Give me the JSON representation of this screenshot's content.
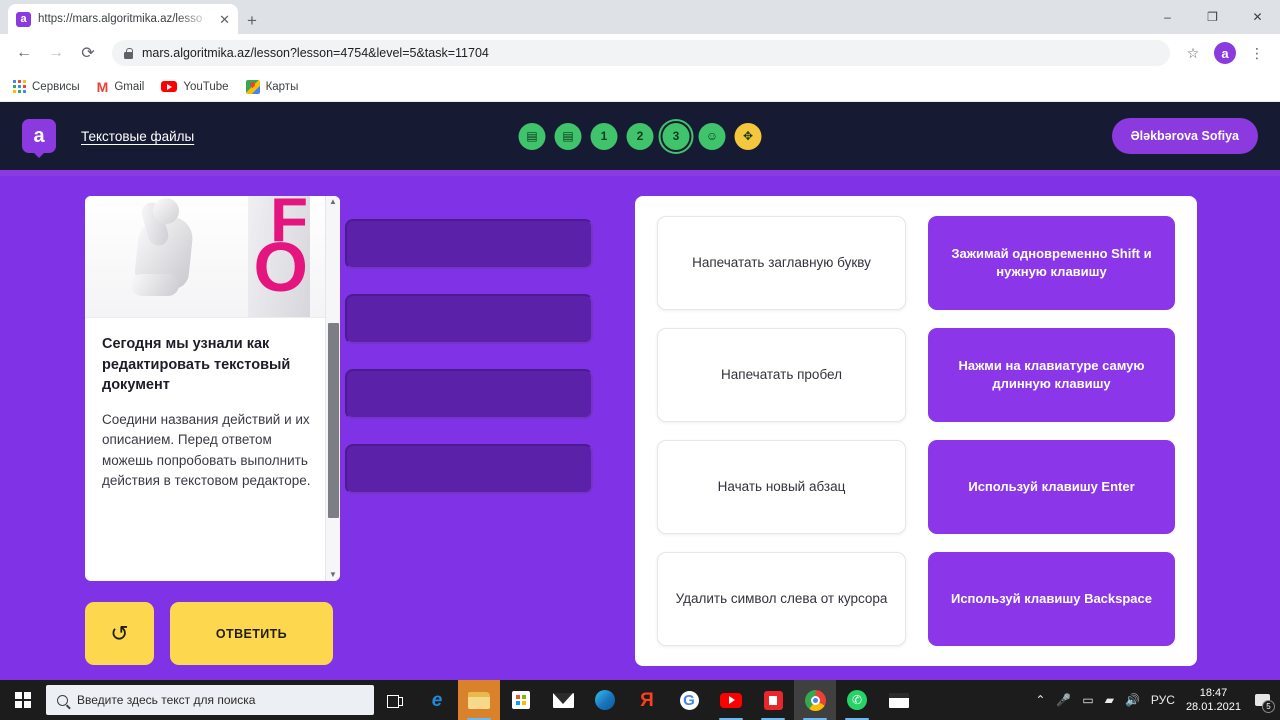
{
  "browser": {
    "tab": {
      "favicon_letter": "a",
      "title": "https://mars.algoritmika.az/lesso",
      "close_icon": "✕"
    },
    "new_tab_icon": "+",
    "window_controls": {
      "minimize": "–",
      "maximize": "❐",
      "close": "✕"
    },
    "nav": {
      "back": "←",
      "forward": "→",
      "reload": "⟳"
    },
    "url": "mars.algoritmika.az/lesson?lesson=4754&level=5&task=11704",
    "bookmark_star": "☆",
    "profile_letter": "a",
    "menu_icon": "⋮",
    "bookmarks": [
      {
        "label": "Сервисы",
        "icon": "apps-grid-icon"
      },
      {
        "label": "Gmail",
        "icon": "gmail-icon"
      },
      {
        "label": "YouTube",
        "icon": "youtube-icon"
      },
      {
        "label": "Карты",
        "icon": "maps-icon"
      }
    ]
  },
  "app_header": {
    "logo_letter": "a",
    "breadcrumb": "Текстовые файлы",
    "user_name": "Ələkbərova Sofiya",
    "steps": [
      {
        "label": "▤",
        "type": "image",
        "state": "done"
      },
      {
        "label": "▤",
        "type": "document",
        "state": "done"
      },
      {
        "label": "1",
        "type": "number",
        "state": "done"
      },
      {
        "label": "2",
        "type": "number",
        "state": "done"
      },
      {
        "label": "3",
        "type": "number",
        "state": "active"
      },
      {
        "label": "☺",
        "type": "smiley",
        "state": "done"
      },
      {
        "label": "✥",
        "type": "bonus",
        "state": "bonus"
      }
    ]
  },
  "lesson": {
    "image_letters": {
      "f": "F",
      "o": "O"
    },
    "title": "Сегодня мы узнали как редактировать текстовый документ",
    "text": "Соедини названия действий и их описанием.\nПеред ответом можешь попробовать выполнить действия в текстовом редакторе.",
    "scroll_up_icon": "▲",
    "scroll_down_icon": "▼",
    "reset_icon": "↺",
    "answer_label": "ОТВЕТИТЬ"
  },
  "slots": [
    {
      "id": "slot-1",
      "content": ""
    },
    {
      "id": "slot-2",
      "content": ""
    },
    {
      "id": "slot-3",
      "content": ""
    },
    {
      "id": "slot-4",
      "content": ""
    }
  ],
  "match_pairs": [
    {
      "term": "Напечатать заглавную букву",
      "definition": "Зажимай одновременно Shift и нужную клавишу"
    },
    {
      "term": "Напечатать пробел",
      "definition": "Нажми на клавиатуре самую длинную клавишу"
    },
    {
      "term": "Начать новый абзац",
      "definition": "Используй клавишу Enter"
    },
    {
      "term": "Удалить символ слева от курсора",
      "definition": "Используй клавишу Backspace"
    }
  ],
  "taskbar": {
    "search_placeholder": "Введите здесь текст для поиска",
    "apps": [
      {
        "name": "task-view",
        "glyph": ""
      },
      {
        "name": "edge-legacy",
        "glyph": "e"
      },
      {
        "name": "file-explorer",
        "glyph": "🗀"
      },
      {
        "name": "microsoft-store",
        "glyph": "🛍"
      },
      {
        "name": "mail",
        "glyph": "✉"
      },
      {
        "name": "edge-chromium",
        "glyph": ""
      },
      {
        "name": "yandex-browser",
        "glyph": "Я"
      },
      {
        "name": "google",
        "glyph": "G"
      },
      {
        "name": "youtube",
        "glyph": "▶"
      },
      {
        "name": "red-app",
        "glyph": "■"
      },
      {
        "name": "chrome",
        "glyph": ""
      },
      {
        "name": "whatsapp",
        "glyph": "✆"
      },
      {
        "name": "movie-maker",
        "glyph": "🎬"
      }
    ],
    "tray": {
      "chevron": "⌃",
      "microphone": "🎤",
      "battery": "▭",
      "wifi": "▰",
      "volume": "🔊",
      "language": "РУС",
      "time": "18:47",
      "date": "28.01.2021",
      "notification_count": "5"
    }
  },
  "colors": {
    "stage_purple": "#8033e6",
    "header_dark": "#161b33",
    "accent_purple": "#8b3ae0",
    "answer_purple": "#8b36e8",
    "slot_purple": "#5b21a8",
    "yellow": "#fdd84e",
    "step_green": "#3fc46b",
    "step_bonus": "#f5c73c"
  }
}
